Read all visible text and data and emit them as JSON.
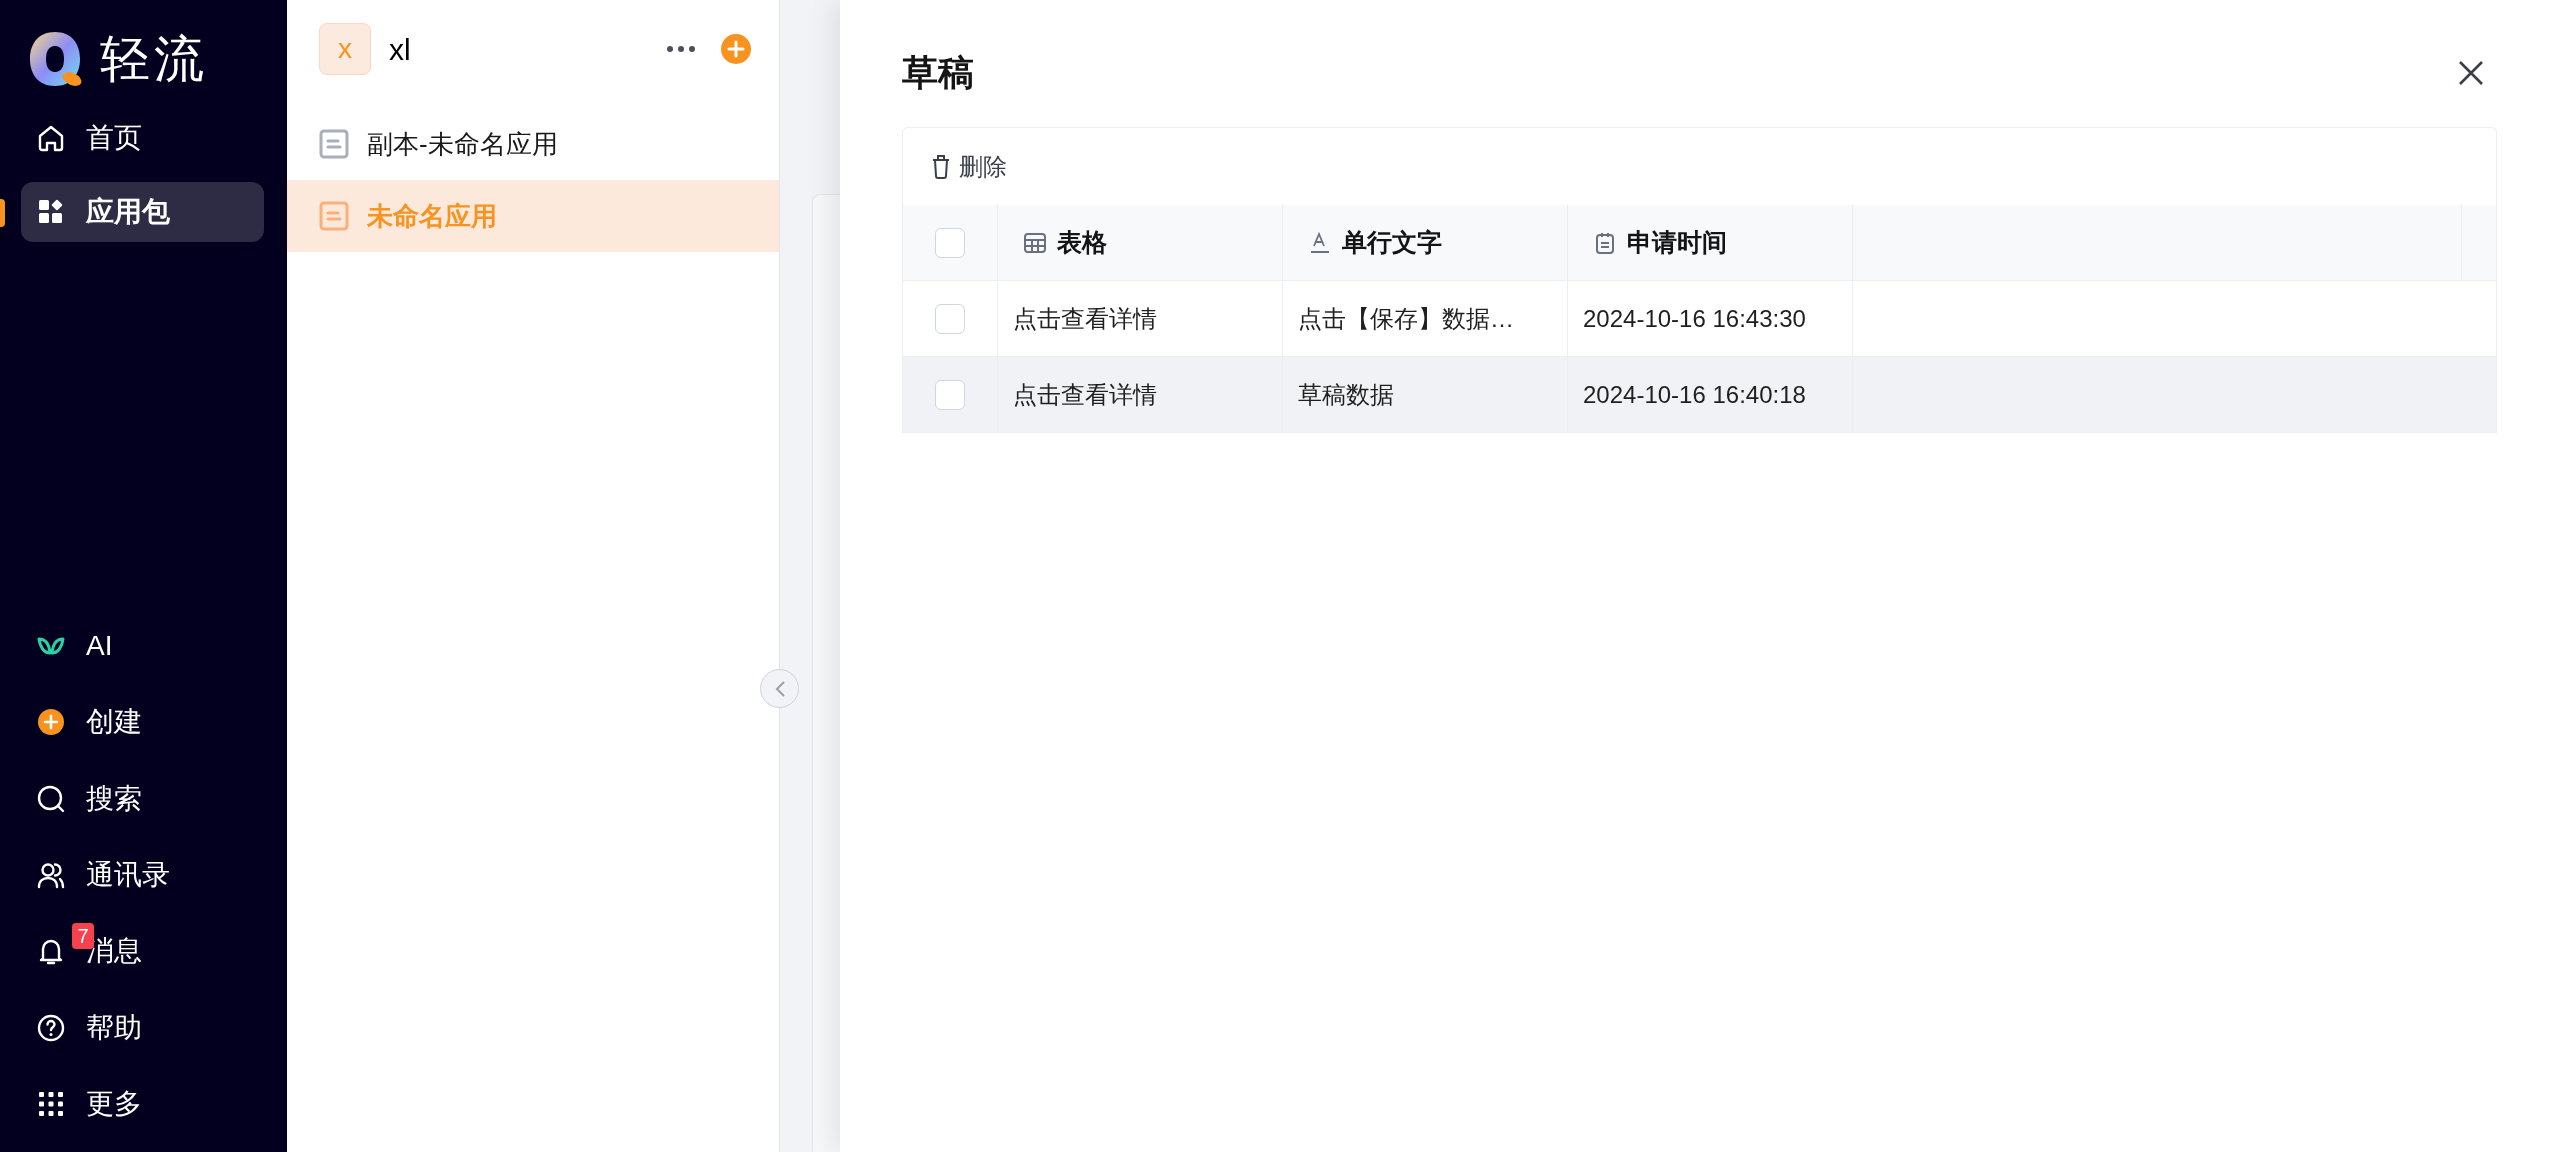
{
  "sidebar": {
    "logo_text": "轻流",
    "items": [
      {
        "label": "首页",
        "kind": "home",
        "selected": false
      },
      {
        "label": "应用包",
        "kind": "apps",
        "selected": true
      }
    ],
    "bottom_items": [
      {
        "label": "AI",
        "kind": "ai"
      },
      {
        "label": "创建",
        "kind": "create"
      },
      {
        "label": "搜索",
        "kind": "search"
      },
      {
        "label": "通讯录",
        "kind": "contacts"
      },
      {
        "label": "消息",
        "kind": "bell",
        "badge": "7"
      },
      {
        "label": "帮助",
        "kind": "help"
      },
      {
        "label": "更多",
        "kind": "more"
      }
    ]
  },
  "workspace": {
    "avatar": "x",
    "name": "xl",
    "apps": [
      {
        "label": "副本-未命名应用",
        "selected": false
      },
      {
        "label": "未命名应用",
        "selected": true
      }
    ]
  },
  "drawer": {
    "title": "草稿",
    "delete_label": "删除",
    "select_all_checked": false,
    "columns": [
      {
        "label": "表格",
        "kind": "table"
      },
      {
        "label": "单行文字",
        "kind": "text"
      },
      {
        "label": "申请时间",
        "kind": "date"
      }
    ],
    "rows": [
      {
        "checked": false,
        "hovered": false,
        "cells": [
          "点击查看详情",
          "点击【保存】数据…",
          "2024-10-16 16:43:30"
        ]
      },
      {
        "checked": false,
        "hovered": true,
        "cells": [
          "点击查看详情",
          "草稿数据",
          "2024-10-16 16:40:18"
        ]
      }
    ]
  }
}
